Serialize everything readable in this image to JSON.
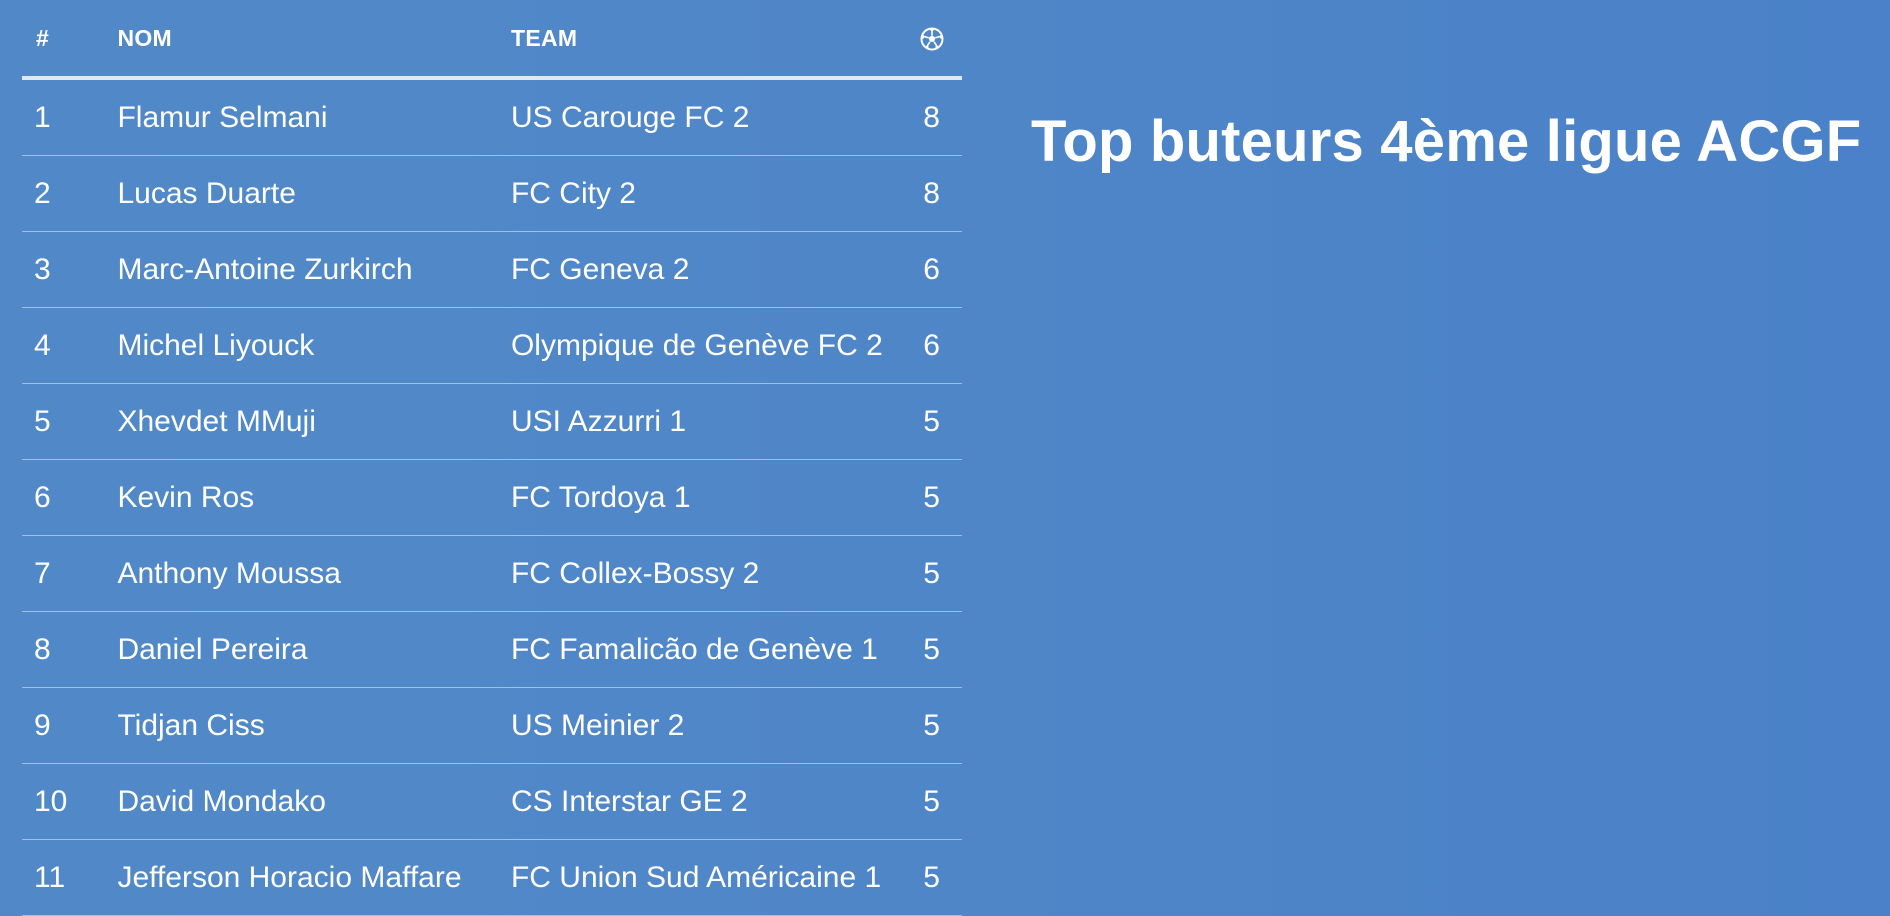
{
  "title": "Top buteurs 4ème ligue ACGF",
  "table": {
    "headers": {
      "rank": "#",
      "name": "NOM",
      "team": "TEAM",
      "goals_icon": "soccer-ball-icon"
    },
    "rows": [
      {
        "rank": "1",
        "name": "Flamur Selmani",
        "team": "US Carouge FC 2",
        "goals": "8"
      },
      {
        "rank": "2",
        "name": "Lucas Duarte",
        "team": "FC City 2",
        "goals": "8"
      },
      {
        "rank": "3",
        "name": "Marc-Antoine Zurkirch",
        "team": "FC Geneva 2",
        "goals": "6"
      },
      {
        "rank": "4",
        "name": "Michel Liyouck",
        "team": "Olympique de Genève FC 2",
        "goals": "6"
      },
      {
        "rank": "5",
        "name": "Xhevdet MMuji",
        "team": "USI Azzurri 1",
        "goals": "5"
      },
      {
        "rank": "6",
        "name": "Kevin Ros",
        "team": "FC Tordoya 1",
        "goals": "5"
      },
      {
        "rank": "7",
        "name": "Anthony Moussa",
        "team": "FC Collex-Bossy 2",
        "goals": "5"
      },
      {
        "rank": "8",
        "name": "Daniel Pereira",
        "team": "FC Famalicão de Genève 1",
        "goals": "5"
      },
      {
        "rank": "9",
        "name": "Tidjan Ciss",
        "team": "US Meinier 2",
        "goals": "5"
      },
      {
        "rank": "10",
        "name": "David Mondako",
        "team": "CS Interstar GE 2",
        "goals": "5"
      },
      {
        "rank": "11",
        "name": "Jefferson Horacio Maffare",
        "team": "FC Union Sud Américaine 1",
        "goals": "5"
      }
    ]
  },
  "colors": {
    "background": "#4f86c8",
    "text": "#ffffff",
    "header_rule": "#dfe9f5"
  }
}
